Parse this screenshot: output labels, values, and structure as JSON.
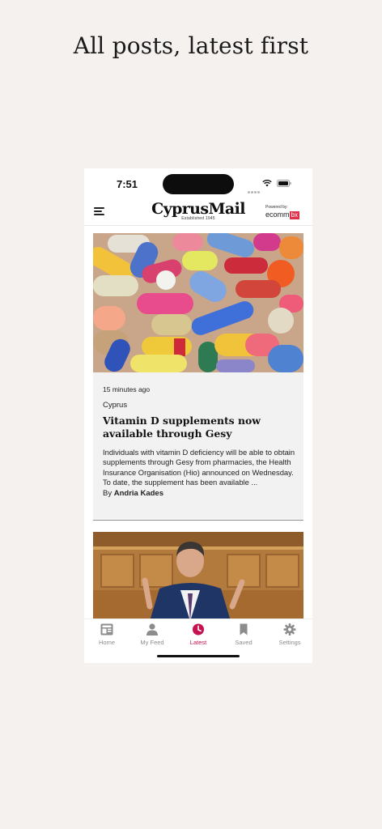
{
  "caption": "All posts, latest first",
  "status_bar": {
    "time": "7:51"
  },
  "header": {
    "logo_text": "CyprusMail",
    "logo_sub": "Established 1945",
    "powered_by_label": "Powered by:",
    "powered_brand": "ecomm",
    "powered_brand_badge": "bx"
  },
  "article": {
    "timestamp": "15 minutes ago",
    "category": "Cyprus",
    "title": "Vitamin D supplements now available through Gesy",
    "excerpt": "Individuals with vitamin D deficiency will be able to obtain supplements through Gesy from pharmacies, the Health Insurance Organisation (Hio) announced on Wednesday.  To date, the supplement has been available ...",
    "byline_prefix": "By",
    "author": "Andria Kades"
  },
  "tabs": [
    {
      "label": "Home",
      "icon": "home-newspaper-icon",
      "active": false
    },
    {
      "label": "My Feed",
      "icon": "person-icon",
      "active": false
    },
    {
      "label": "Latest",
      "icon": "clock-icon",
      "active": true
    },
    {
      "label": "Saved",
      "icon": "bookmark-icon",
      "active": false
    },
    {
      "label": "Settings",
      "icon": "gear-icon",
      "active": false
    }
  ],
  "colors": {
    "accent": "#c4114f",
    "inactive": "#8c8c8c",
    "background": "#f4f1ef"
  }
}
